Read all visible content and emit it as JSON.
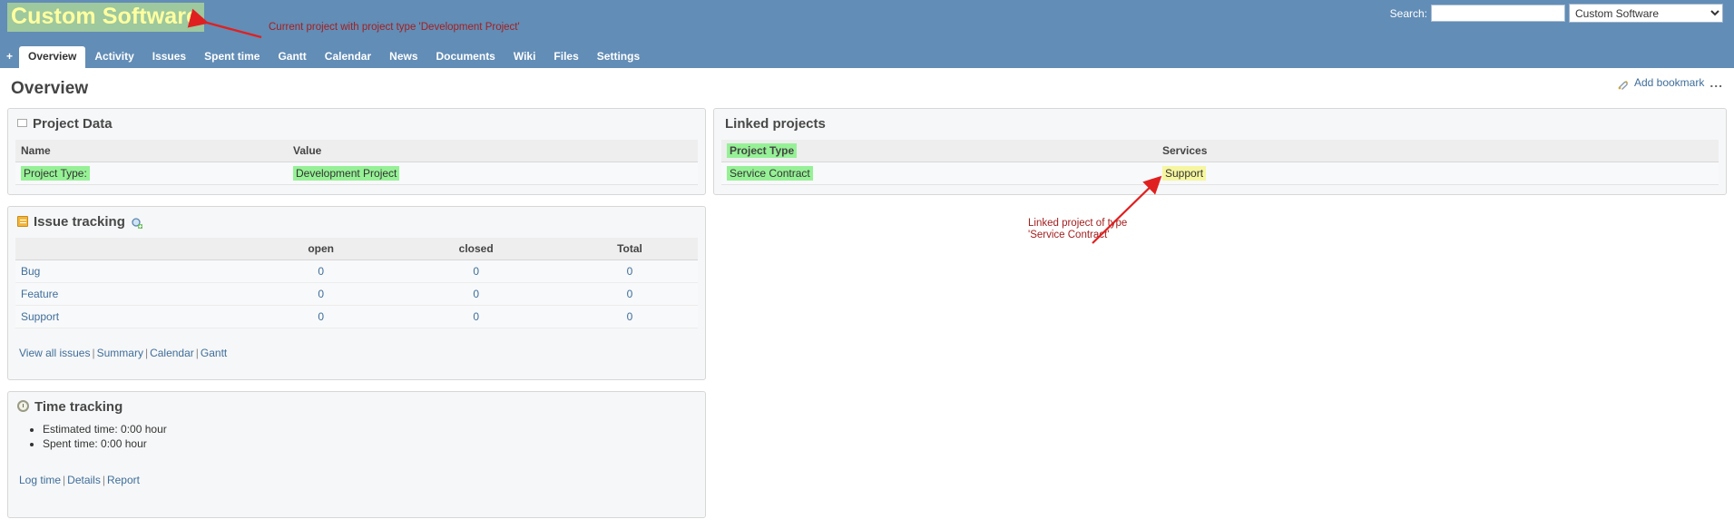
{
  "header": {
    "project_title": "Custom Software",
    "search_label": "Search:",
    "search_value": "",
    "search_placeholder": "",
    "project_select_value": "Custom Software"
  },
  "tabs": [
    {
      "label": "+",
      "name": "add-tab",
      "selected": false
    },
    {
      "label": "Overview",
      "name": "tab-overview",
      "selected": true
    },
    {
      "label": "Activity",
      "name": "tab-activity",
      "selected": false
    },
    {
      "label": "Issues",
      "name": "tab-issues",
      "selected": false
    },
    {
      "label": "Spent time",
      "name": "tab-spent-time",
      "selected": false
    },
    {
      "label": "Gantt",
      "name": "tab-gantt",
      "selected": false
    },
    {
      "label": "Calendar",
      "name": "tab-calendar",
      "selected": false
    },
    {
      "label": "News",
      "name": "tab-news",
      "selected": false
    },
    {
      "label": "Documents",
      "name": "tab-documents",
      "selected": false
    },
    {
      "label": "Wiki",
      "name": "tab-wiki",
      "selected": false
    },
    {
      "label": "Files",
      "name": "tab-files",
      "selected": false
    },
    {
      "label": "Settings",
      "name": "tab-settings",
      "selected": false
    }
  ],
  "page": {
    "title": "Overview",
    "add_bookmark_label": "Add bookmark",
    "actions_label": "..."
  },
  "project_data": {
    "panel_title": "Project Data",
    "columns": [
      "Name",
      "Value"
    ],
    "rows": [
      {
        "name": "Project Type:",
        "value": "Development Project"
      }
    ]
  },
  "issue_tracking": {
    "panel_title": "Issue tracking",
    "columns": [
      "",
      "open",
      "closed",
      "Total"
    ],
    "rows": [
      {
        "tracker": "Bug",
        "open": "0",
        "closed": "0",
        "total": "0"
      },
      {
        "tracker": "Feature",
        "open": "0",
        "closed": "0",
        "total": "0"
      },
      {
        "tracker": "Support",
        "open": "0",
        "closed": "0",
        "total": "0"
      }
    ],
    "links": [
      "View all issues",
      "Summary",
      "Calendar",
      "Gantt"
    ]
  },
  "time_tracking": {
    "panel_title": "Time tracking",
    "items": [
      "Estimated time: 0:00 hour",
      "Spent time: 0:00 hour"
    ],
    "links": [
      "Log time",
      "Details",
      "Report"
    ]
  },
  "linked_projects": {
    "panel_title": "Linked projects",
    "columns": [
      "Project Type",
      "Services"
    ],
    "rows": [
      {
        "project_type": "Service Contract",
        "services": "Support"
      }
    ]
  },
  "annotations": [
    {
      "text": "Current project with project type 'Development Project'"
    },
    {
      "text": "Linked project of type 'Service Contract'"
    }
  ],
  "colors": {
    "header_bg": "#628db6",
    "title_highlight": "#9ec89e",
    "title_text": "#ffffa0",
    "green_highlight": "#96f196",
    "yellow_highlight": "#f6f6a0",
    "annotation_red": "#a32020",
    "link_blue": "#3f6e9a"
  }
}
